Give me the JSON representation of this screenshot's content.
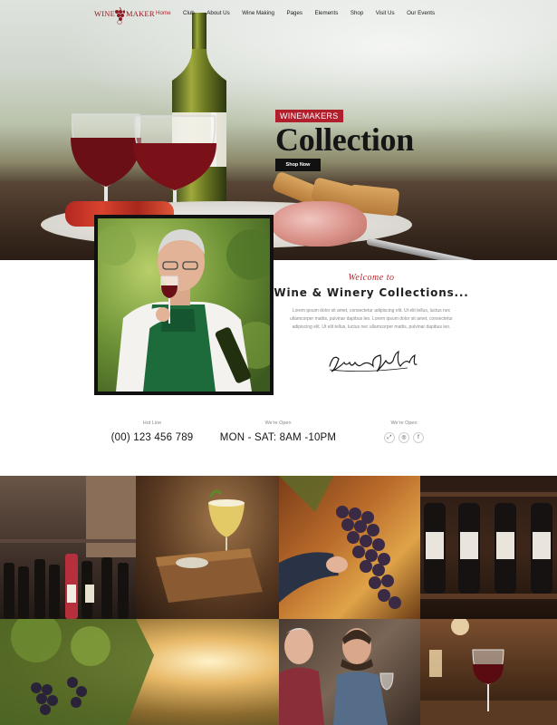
{
  "logo": {
    "word1": "WINE",
    "word2": "MAKER"
  },
  "nav": {
    "items": [
      {
        "label": "Home",
        "active": true
      },
      {
        "label": "Club",
        "active": false
      },
      {
        "label": "About Us",
        "active": false
      },
      {
        "label": "Wine Making",
        "active": false
      },
      {
        "label": "Pages",
        "active": false
      },
      {
        "label": "Elements",
        "active": false
      },
      {
        "label": "Shop",
        "active": false
      },
      {
        "label": "Visit Us",
        "active": false
      },
      {
        "label": "Our Events",
        "active": false
      }
    ]
  },
  "hero": {
    "badge": "WINEMAKERS",
    "title": "Collection",
    "button": "Shop Now"
  },
  "welcome": {
    "script": "Welcome to",
    "title": "Wine & Winery Collections...",
    "body": "Lorem ipsum dolor sit amet, consectetur adipiscing elit. Ut elit tellus, luctus nec ullamcorper mattis, pulvinar dapibus leo. Lorem ipsum dolor sit amet, consectetur adipiscing elit. Ut elit tellus, luctus nec ullamcorper mattis, pulvinar dapibus leo."
  },
  "info": {
    "hotline": {
      "label": "Hot Line",
      "value": "(00) 123 456 789"
    },
    "hours": {
      "label": "We're Open",
      "value": "MON - SAT: 8AM -10PM"
    },
    "social": {
      "label": "We're Open",
      "icons": [
        "share-icon",
        "instagram-icon",
        "facebook-icon"
      ]
    }
  },
  "colors": {
    "accent": "#b21f2c",
    "dark": "#151515",
    "muted_text": "#888888"
  }
}
